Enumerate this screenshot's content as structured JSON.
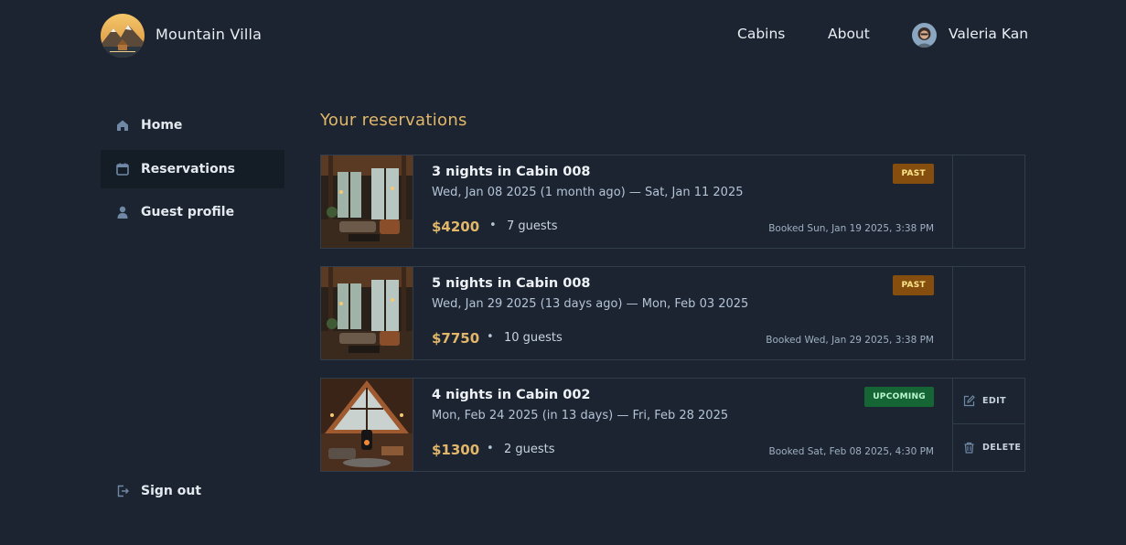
{
  "header": {
    "app_name": "Mountain Villa",
    "nav": [
      {
        "label": "Cabins"
      },
      {
        "label": "About"
      }
    ],
    "user": {
      "name": "Valeria Kan"
    }
  },
  "sidebar": {
    "items": [
      {
        "label": "Home",
        "icon": "home-icon",
        "active": false
      },
      {
        "label": "Reservations",
        "icon": "calendar-icon",
        "active": true
      },
      {
        "label": "Guest profile",
        "icon": "user-icon",
        "active": false
      }
    ],
    "sign_out": {
      "label": "Sign out",
      "icon": "sign-out-icon"
    }
  },
  "main": {
    "title": "Your reservations",
    "reservations": [
      {
        "title": "3 nights in Cabin 008",
        "dates": "Wed, Jan 08 2025 (1 month ago) — Sat, Jan 11 2025",
        "price": "$4200",
        "separator": "•",
        "guests": "7 guests",
        "booked": "Booked Sun, Jan 19 2025, 3:38 PM",
        "status": "PAST"
      },
      {
        "title": "5 nights in Cabin 008",
        "dates": "Wed, Jan 29 2025 (13 days ago) — Mon, Feb 03 2025",
        "price": "$7750",
        "separator": "•",
        "guests": "10 guests",
        "booked": "Booked Wed, Jan 29 2025, 3:38 PM",
        "status": "PAST"
      },
      {
        "title": "4 nights in Cabin 002",
        "dates": "Mon, Feb 24 2025 (in 13 days) — Fri, Feb 28 2025",
        "price": "$1300",
        "separator": "•",
        "guests": "2 guests",
        "booked": "Booked Sat, Feb 08 2025, 4:30 PM",
        "status": "UPCOMING",
        "actions": {
          "edit": "EDIT",
          "delete": "DELETE"
        }
      }
    ]
  },
  "colors": {
    "background": "#1b2430",
    "accent": "#e2b76a",
    "past_badge": "#854d0e",
    "upcoming_badge": "#166534",
    "border": "#313d4b"
  }
}
